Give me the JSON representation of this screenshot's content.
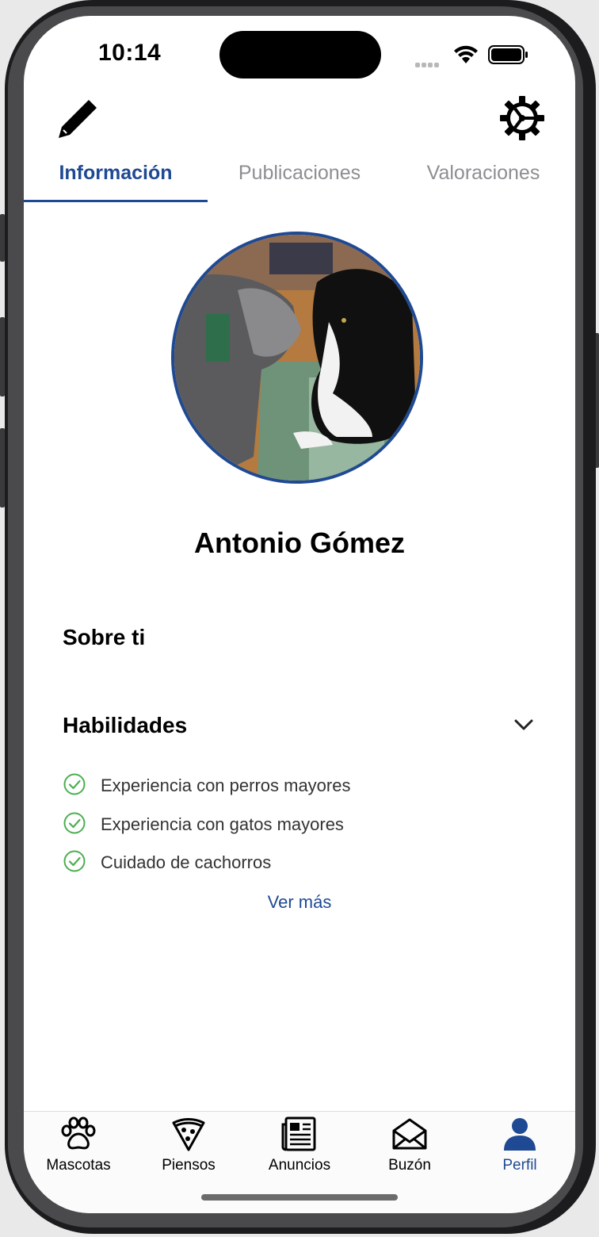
{
  "status": {
    "time": "10:14"
  },
  "tabs": [
    {
      "label": "Información",
      "active": true
    },
    {
      "label": "Publicaciones",
      "active": false
    },
    {
      "label": "Valoraciones",
      "active": false
    }
  ],
  "toolbar": {
    "edit_icon": "pencil-icon",
    "settings_icon": "gear-icon"
  },
  "profile": {
    "name": "Antonio Gómez",
    "avatar": "dog-and-cat-photo"
  },
  "about": {
    "title": "Sobre ti"
  },
  "skills": {
    "title": "Habilidades",
    "items": [
      "Experiencia con perros mayores",
      "Experiencia con gatos mayores",
      "Cuidado de cachorros"
    ],
    "more_link": "Ver más"
  },
  "tabbar": [
    {
      "label": "Mascotas",
      "icon": "paw-icon",
      "active": false
    },
    {
      "label": "Piensos",
      "icon": "pizza-icon",
      "active": false
    },
    {
      "label": "Anuncios",
      "icon": "newspaper-icon",
      "active": false
    },
    {
      "label": "Buzón",
      "icon": "envelope-open-icon",
      "active": false
    },
    {
      "label": "Perfil",
      "icon": "person-icon",
      "active": true
    }
  ],
  "colors": {
    "accent": "#1f4a93",
    "check": "#4caf50"
  }
}
